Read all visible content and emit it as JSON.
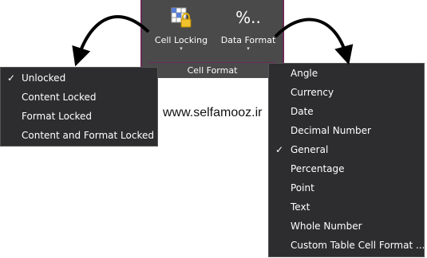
{
  "ribbon": {
    "cell_locking_label": "Cell Locking",
    "data_format_label": "Data Format",
    "data_format_icon_text": "%..",
    "group_label": "Cell Format",
    "caret": "▾"
  },
  "cell_locking_menu": {
    "items": [
      {
        "label": "Unlocked",
        "checked": "✓"
      },
      {
        "label": "Content Locked",
        "checked": ""
      },
      {
        "label": "Format Locked",
        "checked": ""
      },
      {
        "label": "Content and Format Locked",
        "checked": ""
      }
    ]
  },
  "data_format_menu": {
    "items": [
      {
        "label": "Angle",
        "checked": ""
      },
      {
        "label": "Currency",
        "checked": ""
      },
      {
        "label": "Date",
        "checked": ""
      },
      {
        "label": "Decimal Number",
        "checked": ""
      },
      {
        "label": "General",
        "checked": "✓"
      },
      {
        "label": "Percentage",
        "checked": ""
      },
      {
        "label": "Point",
        "checked": ""
      },
      {
        "label": "Text",
        "checked": ""
      },
      {
        "label": "Whole Number",
        "checked": ""
      },
      {
        "label": "Custom Table Cell Format ...",
        "checked": ""
      }
    ]
  },
  "watermark": "www.selfamooz.ir",
  "colors": {
    "ribbon_bg": "#4a4a4a",
    "ribbon_accent": "#6a2a55",
    "menu_bg": "#2d2d30",
    "arrow": "#000000"
  }
}
